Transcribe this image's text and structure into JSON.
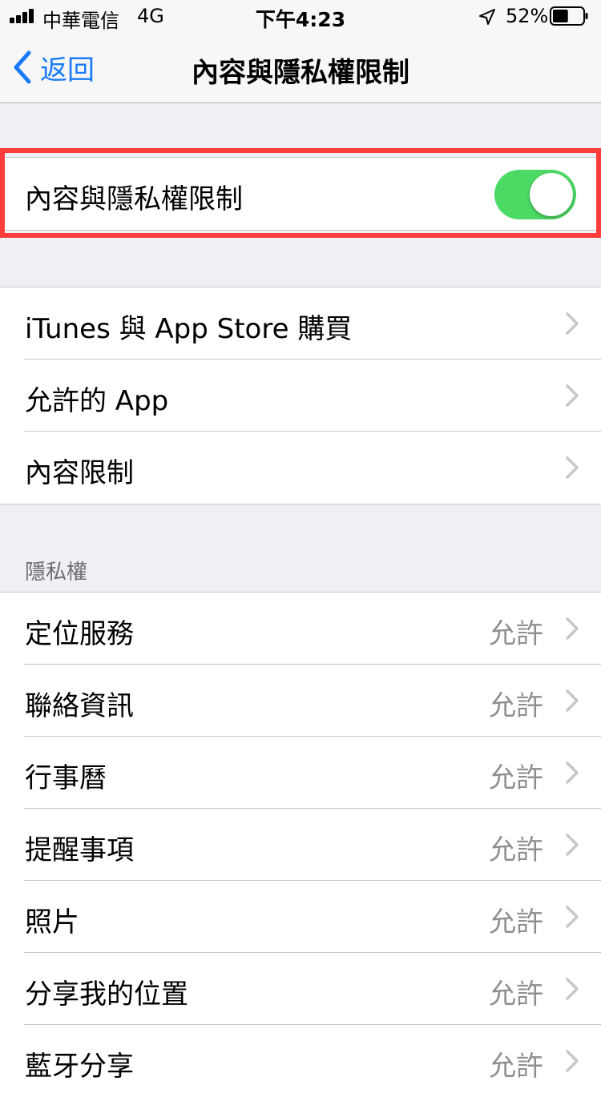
{
  "status_bar": {
    "carrier": "中華電信",
    "network": "4G",
    "time": "下午4:23",
    "battery_percent": "52%",
    "battery_level": 0.52
  },
  "nav": {
    "back_label": "返回",
    "title": "內容與隱私權限制"
  },
  "main_toggle": {
    "label": "內容與隱私權限制",
    "on": true,
    "on_color": "#4cd964"
  },
  "highlight_color": "#ff3b3b",
  "accent_color": "#1a7bfa",
  "menu_items": [
    {
      "label": "iTunes 與 App Store 購買"
    },
    {
      "label": "允許的 App"
    },
    {
      "label": "內容限制"
    }
  ],
  "privacy": {
    "header": "隱私權",
    "items": [
      {
        "label": "定位服務",
        "value": "允許"
      },
      {
        "label": "聯絡資訊",
        "value": "允許"
      },
      {
        "label": "行事曆",
        "value": "允許"
      },
      {
        "label": "提醒事項",
        "value": "允許"
      },
      {
        "label": "照片",
        "value": "允許"
      },
      {
        "label": "分享我的位置",
        "value": "允許"
      },
      {
        "label": "藍牙分享",
        "value": "允許"
      }
    ]
  }
}
